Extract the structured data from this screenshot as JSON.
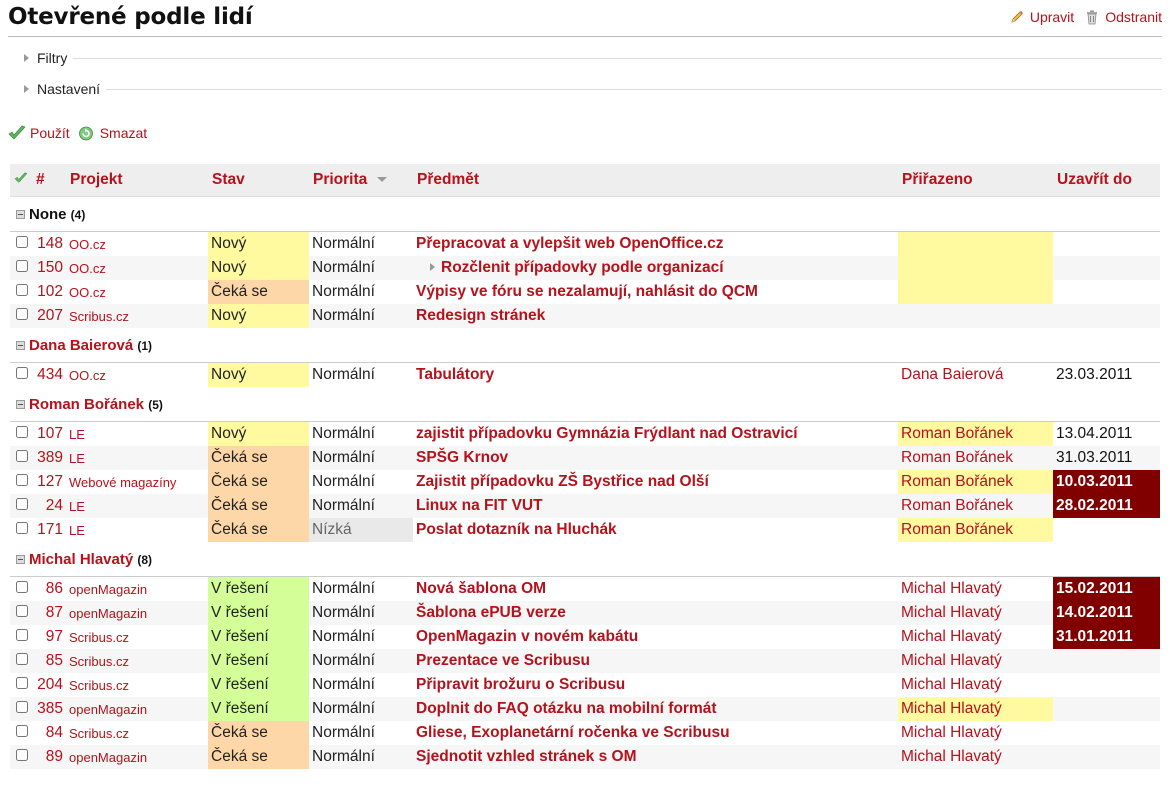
{
  "page": {
    "title": "Otevřené podle lidí",
    "edit_label": "Upravit",
    "delete_label": "Odstranit",
    "filters_label": "Filtry",
    "settings_label": "Nastavení",
    "apply_label": "Použít",
    "clear_label": "Smazat"
  },
  "icons": {
    "edit": "pencil-icon",
    "delete": "trash-icon",
    "apply": "checkmark-icon",
    "clear": "reload-icon",
    "toggle_all": "checkmark-icon"
  },
  "colors": {
    "link": "#b5121b",
    "status_new": "#fffaa0",
    "status_waiting": "#fdd7a8",
    "status_in_progress": "#d4ff98",
    "overdue": "#800000",
    "priority_low": "#e9e9e9"
  },
  "table": {
    "columns": {
      "id": "#",
      "project": "Projekt",
      "status": "Stav",
      "priority": "Priorita",
      "subject": "Předmět",
      "assigned": "Přiřazeno",
      "due": "Uzavřít do"
    },
    "groups": [
      {
        "name": "None",
        "count": "(4)",
        "link": false,
        "rows": [
          {
            "id": "148",
            "project": "OO.cz",
            "status": "Nový",
            "status_cls": "new",
            "priority": "Normální",
            "subject": "Přepracovat a vylepšit web OpenOffice.cz",
            "assigned": "",
            "assigned_hl": true,
            "due": "",
            "overdue": false,
            "sub": false
          },
          {
            "id": "150",
            "project": "OO.cz",
            "status": "Nový",
            "status_cls": "new",
            "priority": "Normální",
            "subject": "Rozčlenit případovky podle organizací",
            "assigned": "",
            "assigned_hl": true,
            "due": "",
            "overdue": false,
            "sub": true
          },
          {
            "id": "102",
            "project": "OO.cz",
            "status": "Čeká se",
            "status_cls": "wait",
            "priority": "Normální",
            "subject": "Výpisy ve fóru se nezalamují, nahlásit do QCM",
            "assigned": "",
            "assigned_hl": true,
            "due": "",
            "overdue": false,
            "sub": false
          },
          {
            "id": "207",
            "project": "Scribus.cz",
            "status": "Nový",
            "status_cls": "new",
            "priority": "Normální",
            "subject": "Redesign stránek",
            "assigned": "",
            "assigned_hl": false,
            "due": "",
            "overdue": false,
            "sub": false
          }
        ]
      },
      {
        "name": "Dana Baierová",
        "count": "(1)",
        "link": true,
        "rows": [
          {
            "id": "434",
            "project": "OO.cz",
            "status": "Nový",
            "status_cls": "new",
            "priority": "Normální",
            "subject": "Tabulátory",
            "assigned": "Dana Baierová",
            "assigned_hl": false,
            "due": "23.03.2011",
            "overdue": false,
            "sub": false
          }
        ]
      },
      {
        "name": "Roman Bořánek",
        "count": "(5)",
        "link": true,
        "rows": [
          {
            "id": "107",
            "project": "LE",
            "status": "Nový",
            "status_cls": "new",
            "priority": "Normální",
            "subject": "zajistit případovku Gymnázia Frýdlant nad Ostravicí",
            "assigned": "Roman Bořánek",
            "assigned_hl": true,
            "due": "13.04.2011",
            "overdue": false,
            "sub": false
          },
          {
            "id": "389",
            "project": "LE",
            "status": "Čeká se",
            "status_cls": "wait",
            "priority": "Normální",
            "subject": "SPŠG Krnov",
            "assigned": "Roman Bořánek",
            "assigned_hl": false,
            "due": "31.03.2011",
            "overdue": false,
            "sub": false
          },
          {
            "id": "127",
            "project": "Webové magazíny",
            "status": "Čeká se",
            "status_cls": "wait",
            "priority": "Normální",
            "subject": "Zajistit případovku ZŠ Bystřice nad Olší",
            "assigned": "Roman Bořánek",
            "assigned_hl": true,
            "due": "10.03.2011",
            "overdue": true,
            "sub": false
          },
          {
            "id": "24",
            "project": "LE",
            "status": "Čeká se",
            "status_cls": "wait",
            "priority": "Normální",
            "subject": "Linux na FIT VUT",
            "assigned": "Roman Bořánek",
            "assigned_hl": false,
            "due": "28.02.2011",
            "overdue": true,
            "sub": false
          },
          {
            "id": "171",
            "project": "LE",
            "status": "Čeká se",
            "status_cls": "wait",
            "priority": "Nízká",
            "prio_cls": "low",
            "subject": "Poslat dotazník na Hluchák",
            "assigned": "Roman Bořánek",
            "assigned_hl": true,
            "due": "",
            "overdue": false,
            "sub": false
          }
        ]
      },
      {
        "name": "Michal Hlavatý",
        "count": "(8)",
        "link": true,
        "rows": [
          {
            "id": "86",
            "project": "openMagazin",
            "status": "V řešení",
            "status_cls": "prog",
            "priority": "Normální",
            "subject": "Nová šablona OM",
            "assigned": "Michal Hlavatý",
            "assigned_hl": false,
            "due": "15.02.2011",
            "overdue": true,
            "sub": false
          },
          {
            "id": "87",
            "project": "openMagazin",
            "status": "V řešení",
            "status_cls": "prog",
            "priority": "Normální",
            "subject": "Šablona ePUB verze",
            "assigned": "Michal Hlavatý",
            "assigned_hl": false,
            "due": "14.02.2011",
            "overdue": true,
            "sub": false
          },
          {
            "id": "97",
            "project": "Scribus.cz",
            "status": "V řešení",
            "status_cls": "prog",
            "priority": "Normální",
            "subject": "OpenMagazin v novém kabátu",
            "assigned": "Michal Hlavatý",
            "assigned_hl": false,
            "due": "31.01.2011",
            "overdue": true,
            "sub": false
          },
          {
            "id": "85",
            "project": "Scribus.cz",
            "status": "V řešení",
            "status_cls": "prog",
            "priority": "Normální",
            "subject": "Prezentace ve Scribusu",
            "assigned": "Michal Hlavatý",
            "assigned_hl": false,
            "due": "",
            "overdue": false,
            "sub": false
          },
          {
            "id": "204",
            "project": "Scribus.cz",
            "status": "V řešení",
            "status_cls": "prog",
            "priority": "Normální",
            "subject": "Připravit brožuru o Scribusu",
            "assigned": "Michal Hlavatý",
            "assigned_hl": false,
            "due": "",
            "overdue": false,
            "sub": false
          },
          {
            "id": "385",
            "project": "openMagazin",
            "status": "V řešení",
            "status_cls": "prog",
            "priority": "Normální",
            "subject": "Doplnit do FAQ otázku na mobilní formát",
            "assigned": "Michal Hlavatý",
            "assigned_hl": true,
            "due": "",
            "overdue": false,
            "sub": false
          },
          {
            "id": "84",
            "project": "Scribus.cz",
            "status": "Čeká se",
            "status_cls": "wait",
            "priority": "Normální",
            "subject": "Gliese, Exoplanetární ročenka ve Scribusu",
            "assigned": "Michal Hlavatý",
            "assigned_hl": false,
            "due": "",
            "overdue": false,
            "sub": false
          },
          {
            "id": "89",
            "project": "openMagazin",
            "status": "Čeká se",
            "status_cls": "wait",
            "priority": "Normální",
            "subject": "Sjednotit vzhled stránek s OM",
            "assigned": "Michal Hlavatý",
            "assigned_hl": false,
            "due": "",
            "overdue": false,
            "sub": false
          }
        ]
      }
    ]
  }
}
